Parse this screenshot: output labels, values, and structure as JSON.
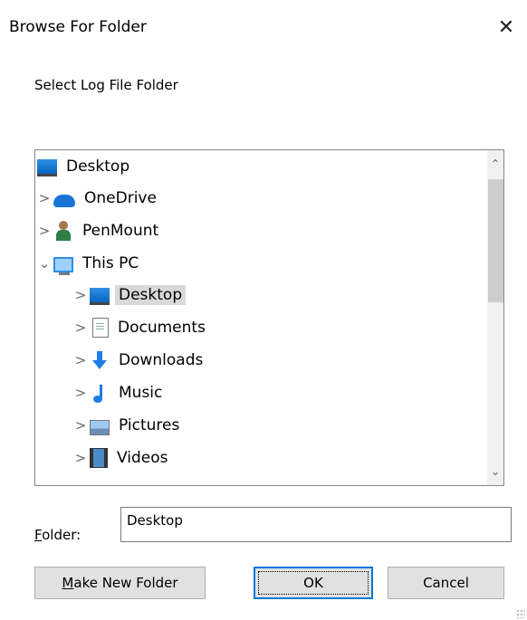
{
  "window": {
    "title": "Browse For Folder",
    "close_glyph": "✕"
  },
  "prompt": "Select Log File Folder",
  "tree": {
    "items": [
      {
        "label": "Desktop",
        "icon": "desktop-icon",
        "level": 0,
        "expander": "none",
        "selected": false
      },
      {
        "label": "OneDrive",
        "icon": "cloud-icon",
        "level": 1,
        "expander": "collapsed",
        "selected": false
      },
      {
        "label": "PenMount",
        "icon": "user-icon",
        "level": 1,
        "expander": "collapsed",
        "selected": false
      },
      {
        "label": "This PC",
        "icon": "computer-icon",
        "level": 1,
        "expander": "expanded",
        "selected": false
      },
      {
        "label": "Desktop",
        "icon": "desktop-icon",
        "level": 2,
        "expander": "collapsed",
        "selected": true
      },
      {
        "label": "Documents",
        "icon": "documents-icon",
        "level": 2,
        "expander": "collapsed",
        "selected": false
      },
      {
        "label": "Downloads",
        "icon": "downloads-icon",
        "level": 2,
        "expander": "collapsed",
        "selected": false
      },
      {
        "label": "Music",
        "icon": "music-icon",
        "level": 2,
        "expander": "collapsed",
        "selected": false
      },
      {
        "label": "Pictures",
        "icon": "pictures-icon",
        "level": 2,
        "expander": "collapsed",
        "selected": false
      },
      {
        "label": "Videos",
        "icon": "videos-icon",
        "level": 2,
        "expander": "collapsed",
        "selected": false
      }
    ]
  },
  "folder": {
    "label_prefix": "F",
    "label_rest": "older:",
    "value": "Desktop"
  },
  "buttons": {
    "make_new_prefix": "M",
    "make_new_rest": "ake New Folder",
    "ok": "OK",
    "cancel": "Cancel"
  }
}
